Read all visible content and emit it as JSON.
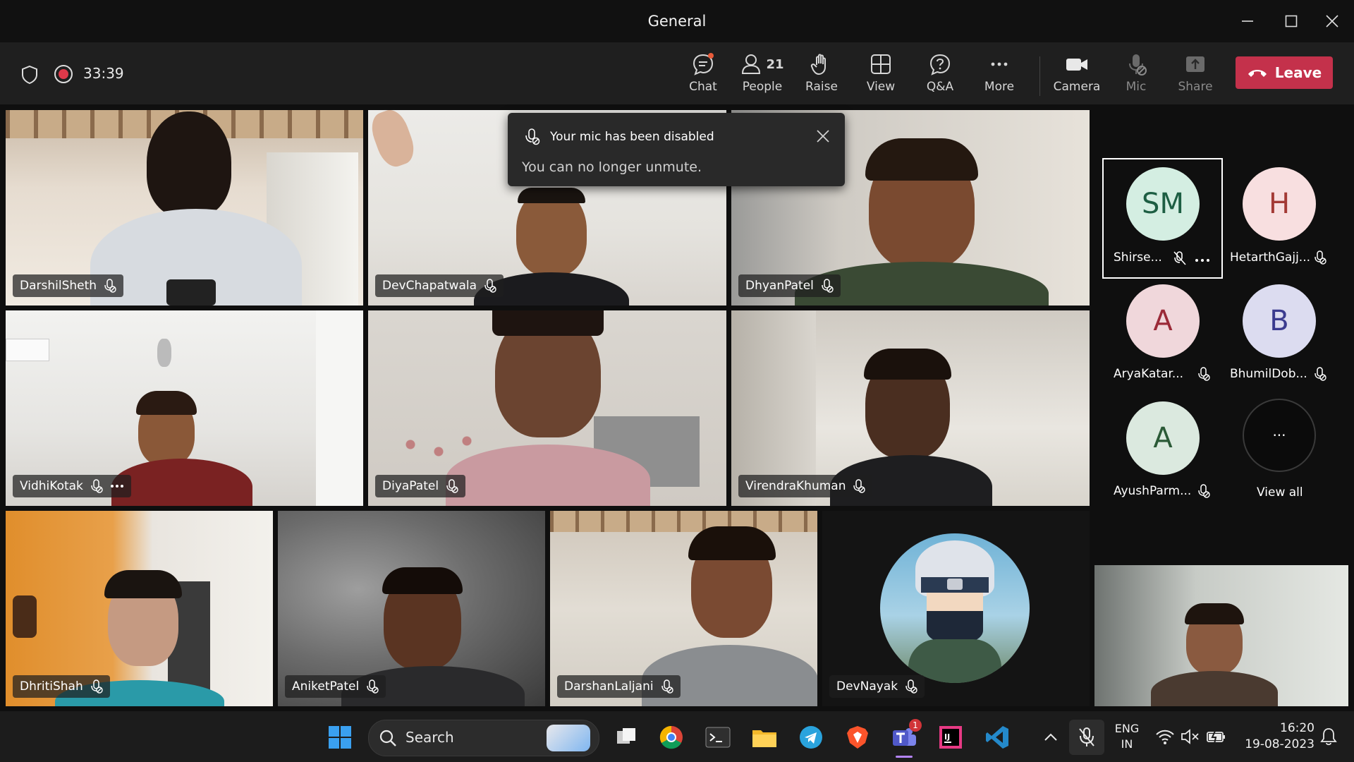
{
  "window": {
    "title": "General"
  },
  "meeting": {
    "timer": "33:39"
  },
  "toolbar": {
    "chat": "Chat",
    "people": "People",
    "people_count": "21",
    "raise": "Raise",
    "view": "View",
    "qa": "Q&A",
    "more": "More",
    "camera": "Camera",
    "mic": "Mic",
    "share": "Share",
    "leave": "Leave"
  },
  "toast": {
    "title": "Your mic has been disabled",
    "message": "You can no longer unmute."
  },
  "participants": [
    {
      "name": "DarshilSheth"
    },
    {
      "name": "DevChapatwala"
    },
    {
      "name": "DhyanPatel"
    },
    {
      "name": "VidhiKotak"
    },
    {
      "name": "DiyaPatel"
    },
    {
      "name": "VirendraKhuman"
    },
    {
      "name": "DhritiShah"
    },
    {
      "name": "AniketPatel"
    },
    {
      "name": "DarshanLaljani"
    },
    {
      "name": "DevNayak"
    }
  ],
  "roster": [
    {
      "initials": "SM",
      "name": "Shirse..."
    },
    {
      "initials": "H",
      "name": "HetarthGajj..."
    },
    {
      "initials": "A",
      "name": "AryaKatar..."
    },
    {
      "initials": "B",
      "name": "BhumilDob..."
    },
    {
      "initials": "A",
      "name": "AyushParm..."
    },
    {
      "initials": "···",
      "name": "View all"
    }
  ],
  "colors": {
    "leave": "#c4314b",
    "recording": "#e0394a",
    "avatar_sm": "#d4eee2",
    "avatar_h": "#f8dfe0",
    "avatar_a": "#f0d7db",
    "avatar_b": "#dcdcf0",
    "avatar_a2": "#dbe9df"
  },
  "taskbar": {
    "search": "Search",
    "lang1": "ENG",
    "lang2": "IN",
    "time": "16:20",
    "date": "19-08-2023",
    "teams_badge": "1"
  }
}
